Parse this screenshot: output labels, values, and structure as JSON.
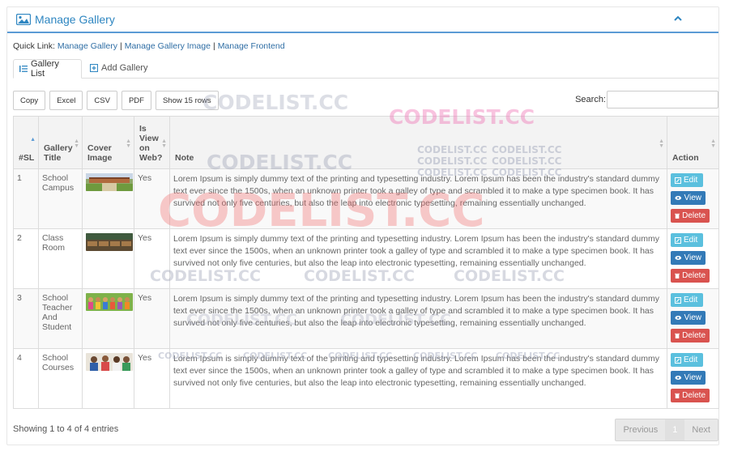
{
  "panel": {
    "title": "Manage Gallery"
  },
  "quick_links": {
    "label": "Quick Link:",
    "items": [
      "Manage Gallery",
      "Manage Gallery Image",
      "Manage Frontend"
    ],
    "separator": "|"
  },
  "tabs": [
    {
      "label": "Gallery List",
      "active": true
    },
    {
      "label": "Add Gallery",
      "active": false
    }
  ],
  "toolbar": {
    "buttons": [
      "Copy",
      "Excel",
      "CSV",
      "PDF",
      "Show 15 rows"
    ],
    "search_label": "Search:",
    "search_value": ""
  },
  "table": {
    "columns": [
      "#SL",
      "Gallery Title",
      "Cover Image",
      "Is View on Web?",
      "Note",
      "Action"
    ],
    "rows": [
      {
        "sl": "1",
        "title": "School Campus",
        "view": "Yes",
        "note": "Lorem Ipsum is simply dummy text of the printing and typesetting industry. Lorem Ipsum has been the industry's standard dummy text ever since the 1500s, when an unknown printer took a galley of type and scrambled it to make a type specimen book. It has survived not only five centuries, but also the leap into electronic typesetting, remaining essentially unchanged."
      },
      {
        "sl": "2",
        "title": "Class Room",
        "view": "Yes",
        "note": "Lorem Ipsum is simply dummy text of the printing and typesetting industry. Lorem Ipsum has been the industry's standard dummy text ever since the 1500s, when an unknown printer took a galley of type and scrambled it to make a type specimen book. It has survived not only five centuries, but also the leap into electronic typesetting, remaining essentially unchanged."
      },
      {
        "sl": "3",
        "title": "School Teacher And Student",
        "view": "Yes",
        "note": "Lorem Ipsum is simply dummy text of the printing and typesetting industry. Lorem Ipsum has been the industry's standard dummy text ever since the 1500s, when an unknown printer took a galley of type and scrambled it to make a type specimen book. It has survived not only five centuries, but also the leap into electronic typesetting, remaining essentially unchanged."
      },
      {
        "sl": "4",
        "title": "School Courses",
        "view": "Yes",
        "note": "Lorem Ipsum is simply dummy text of the printing and typesetting industry. Lorem Ipsum has been the industry's standard dummy text ever since the 1500s, when an unknown printer took a galley of type and scrambled it to make a type specimen book. It has survived not only five centuries, but also the leap into electronic typesetting, remaining essentially unchanged."
      }
    ],
    "actions": {
      "edit": "Edit",
      "view": "View",
      "delete": "Delete"
    }
  },
  "footer": {
    "info": "Showing 1 to 4 of 4 entries",
    "previous": "Previous",
    "page": "1",
    "next": "Next"
  },
  "watermark": "CODELIST.CC",
  "colors": {
    "accent": "#2e86c1",
    "edit": "#5bc0de",
    "view": "#337ab7",
    "delete": "#d9534f",
    "watermark_red": "#f26b6b",
    "watermark_pink": "#f07ab8",
    "watermark_gray": "#9aa0b5"
  }
}
